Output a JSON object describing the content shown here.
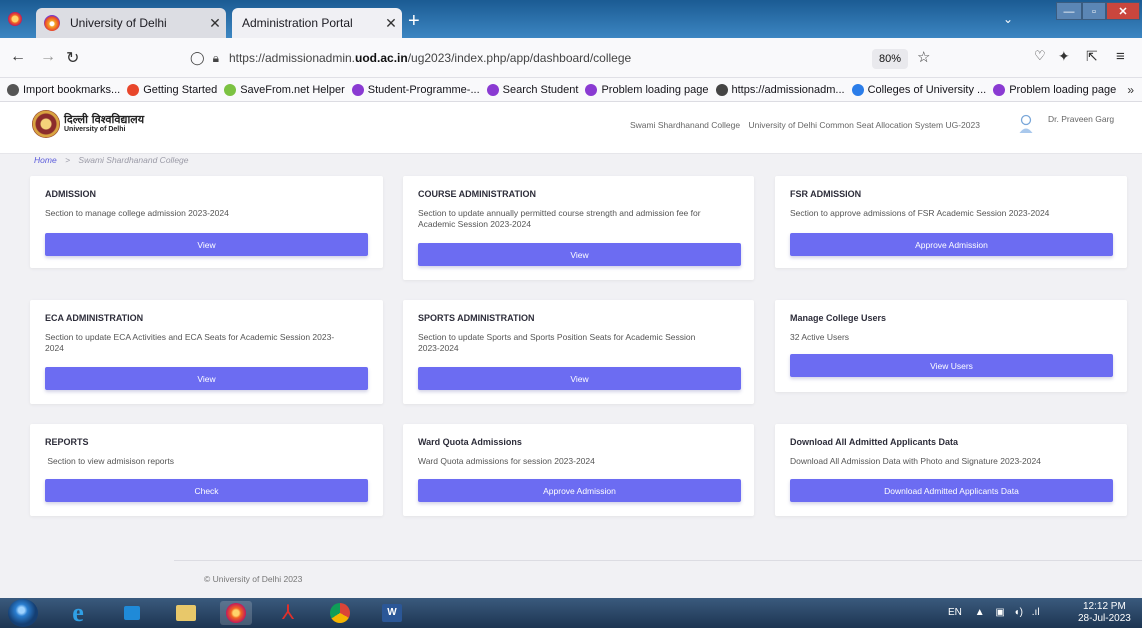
{
  "browser": {
    "tabs": [
      {
        "label": "University of Delhi",
        "active": false
      },
      {
        "label": "Administration Portal",
        "active": true
      }
    ],
    "new_tab": "+",
    "url_prefix": "https://admissionadmin.",
    "url_domain": "uod.ac.in",
    "url_suffix": "/ug2023/index.php/app/dashboard/college",
    "zoom": "80%",
    "bookmarks": [
      {
        "label": "Import bookmarks...",
        "icon": "import-icon",
        "color": "#555555"
      },
      {
        "label": "Getting Started",
        "icon": "firefox-icon",
        "color": "#e8462b"
      },
      {
        "label": "SaveFrom.net Helper",
        "icon": "arrow-down-icon",
        "color": "#7cc242"
      },
      {
        "label": "Student-Programme-...",
        "icon": "du-favicon-icon",
        "color": "#8a3ad2"
      },
      {
        "label": "Search Student",
        "icon": "du-favicon-icon",
        "color": "#8a3ad2"
      },
      {
        "label": "Problem loading page",
        "icon": "du-favicon-icon",
        "color": "#8a3ad2"
      },
      {
        "label": "https://admissionadm...",
        "icon": "globe-icon",
        "color": "#444444"
      },
      {
        "label": "Colleges of University ...",
        "icon": "colleges-icon",
        "color": "#2b7de9"
      },
      {
        "label": "Problem loading page",
        "icon": "du-favicon-icon",
        "color": "#8a3ad2"
      }
    ]
  },
  "header": {
    "logo_hindi": "दिल्ली विश्वविद्यालय",
    "logo_english": "University of Delhi",
    "college": "Swami Shardhanand College",
    "system": "University of Delhi Common Seat Allocation System UG-2023",
    "user": "Dr. Praveen Garg"
  },
  "breadcrumb": {
    "home": "Home",
    "separator": ">",
    "current": "Swami Shardhanand College"
  },
  "cards": [
    {
      "title": "ADMISSION",
      "desc": "Section to manage college admission 2023-2024",
      "button": "View"
    },
    {
      "title": "COURSE ADMINISTRATION",
      "desc": "Section to update annually permitted course strength and admission fee for Academic Session 2023-2024",
      "button": "View"
    },
    {
      "title": "FSR ADMISSION",
      "desc": "Section to approve admissions of FSR Academic Session 2023-2024",
      "button": "Approve Admission"
    },
    {
      "title": "ECA ADMINISTRATION",
      "desc": "Section to update ECA Activities and ECA Seats for Academic Session 2023-2024",
      "button": "View"
    },
    {
      "title": "SPORTS ADMINISTRATION",
      "desc": "Section to update Sports and Sports Position Seats for Academic Session 2023-2024",
      "button": "View"
    },
    {
      "title": "Manage College Users",
      "desc": "32 Active Users",
      "button": "View Users"
    },
    {
      "title": "REPORTS",
      "desc": " Section to view admisison reports",
      "button": "Check"
    },
    {
      "title": "Ward Quota Admissions",
      "desc": "Ward Quota admissions for session 2023-2024",
      "button": "Approve Admission"
    },
    {
      "title": "Download All Admitted Applicants Data",
      "desc": "Download All Admission Data with Photo and Signature 2023-2024",
      "button": "Download Admitted Applicants Data"
    }
  ],
  "footer": "© University of Delhi 2023",
  "taskbar": {
    "lang": "EN",
    "time": "12:12 PM",
    "date": "28-Jul-2023"
  },
  "colors": {
    "accent": "#6c6cf2",
    "page_bg": "#f1f1f4"
  }
}
